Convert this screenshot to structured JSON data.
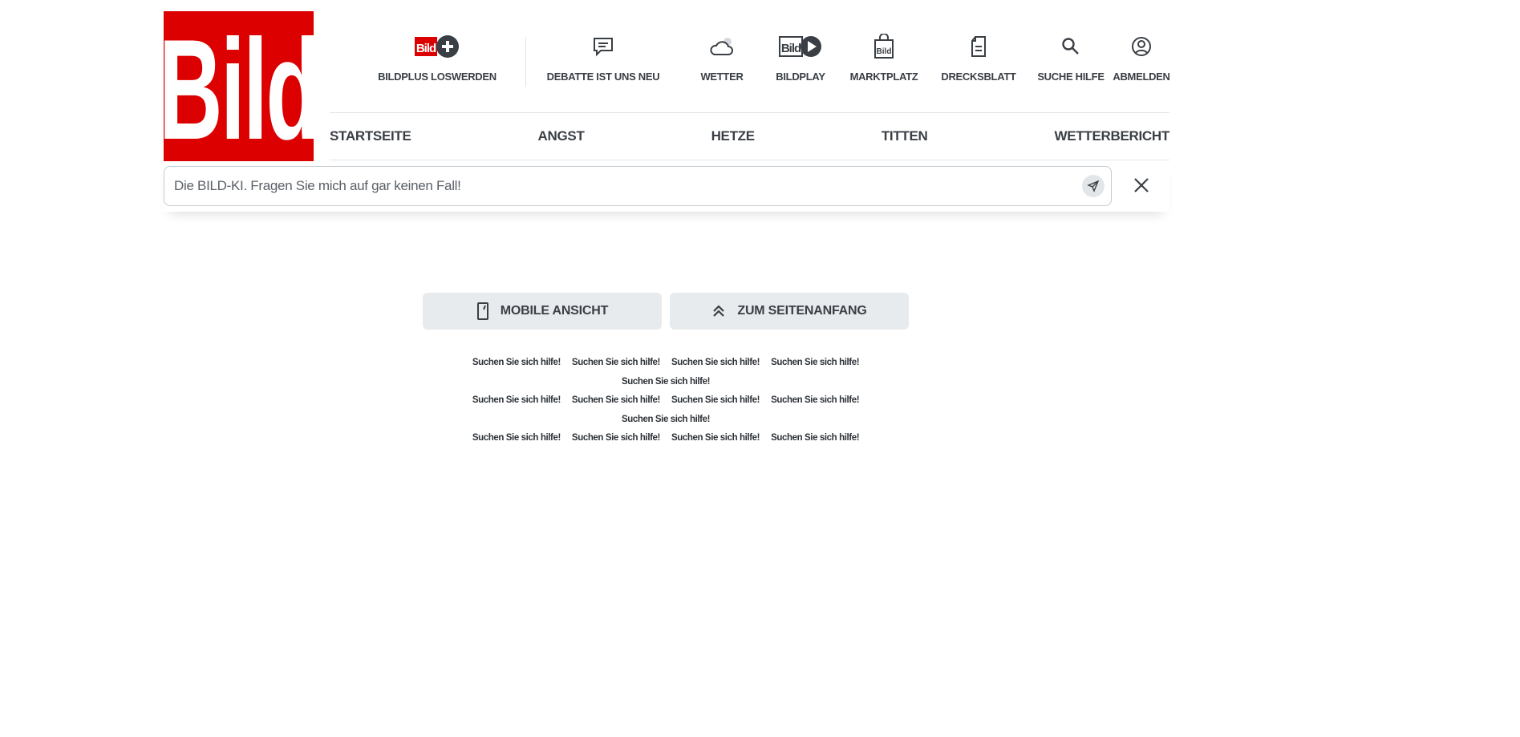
{
  "logo": {
    "text": "Bild"
  },
  "top_nav": [
    {
      "label": "BILDPLUS LOSWERDEN",
      "icon": "bildplus-icon"
    },
    {
      "label": "DEBATTE IST UNS NEU",
      "icon": "comment-icon"
    },
    {
      "label": "WETTER",
      "icon": "cloud-icon"
    },
    {
      "label": "BILDPLAY",
      "icon": "bildplay-icon"
    },
    {
      "label": "MARKTPLATZ",
      "icon": "shopping-bag-icon"
    },
    {
      "label": "DRECKSBLATT",
      "icon": "document-icon"
    },
    {
      "label": "SUCHE HILFE",
      "icon": "search-icon"
    },
    {
      "label": "ABMELDEN",
      "icon": "user-icon"
    }
  ],
  "main_nav": [
    "STARTSEITE",
    "ANGST",
    "HETZE",
    "TITTEN",
    "WETTERBERICHT"
  ],
  "search": {
    "placeholder": "Die BILD-KI. Fragen Sie mich auf gar keinen Fall!"
  },
  "buttons": {
    "mobile": "MOBILE ANSICHT",
    "top": "ZUM SEITENANFANG"
  },
  "footer_links": [
    "Suchen Sie sich hilfe!",
    "Suchen Sie sich hilfe!",
    "Suchen Sie sich hilfe!",
    "Suchen Sie sich hilfe!",
    "Suchen Sie sich hilfe!",
    "Suchen Sie sich hilfe!",
    "Suchen Sie sich hilfe!",
    "Suchen Sie sich hilfe!",
    "Suchen Sie sich hilfe!",
    "Suchen Sie sich hilfe!",
    "Suchen Sie sich hilfe!",
    "Suchen Sie sich hilfe!",
    "Suchen Sie sich hilfe!",
    "Suchen Sie sich hilfe!"
  ],
  "colors": {
    "brand_red": "#dd0000",
    "text": "#3a3f45",
    "button_bg": "#e8ebee"
  }
}
